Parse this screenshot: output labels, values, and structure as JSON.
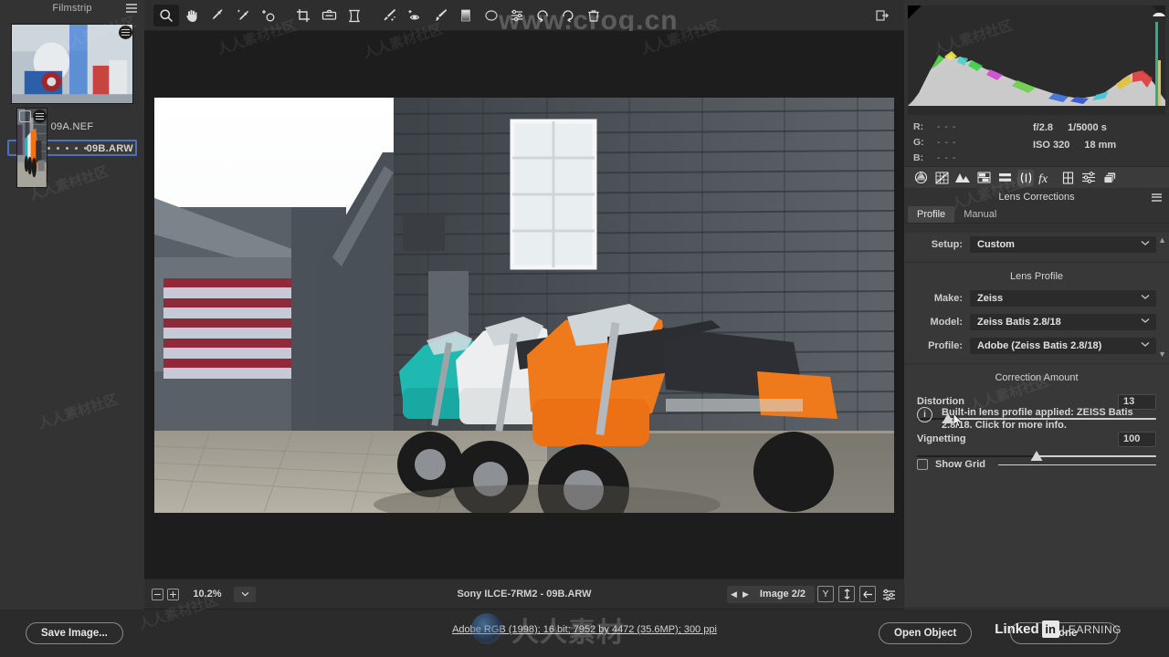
{
  "filmstrip": {
    "title": "Filmstrip",
    "menu_icon": "hamburger-icon",
    "items": [
      {
        "name": "09A.NEF",
        "selected": false,
        "dots": 0
      },
      {
        "name": "09B.ARW",
        "selected": true,
        "dots": 5
      }
    ]
  },
  "toolbar": {
    "tools": [
      {
        "name": "zoom-tool",
        "icon": "magnifier-icon",
        "active": true
      },
      {
        "name": "hand-tool",
        "icon": "hand-icon",
        "active": false
      },
      {
        "name": "white-balance-tool",
        "icon": "eyedropper-icon",
        "active": false
      },
      {
        "name": "color-sampler-tool",
        "icon": "eyedropper-sparkle-icon",
        "active": false
      },
      {
        "name": "targeted-adjustment-tool",
        "icon": "target-adjust-icon",
        "active": false
      },
      {
        "name": "crop-tool",
        "icon": "crop-icon",
        "active": false
      },
      {
        "name": "straighten-tool",
        "icon": "straighten-icon",
        "active": false
      },
      {
        "name": "transform-tool",
        "icon": "transform-icon",
        "active": false
      },
      {
        "name": "spot-removal-tool",
        "icon": "spot-heal-icon",
        "active": false
      },
      {
        "name": "adjustment-brush-tool",
        "icon": "brush-icon",
        "active": false
      },
      {
        "name": "red-eye-tool",
        "icon": "red-eye-icon",
        "active": false
      },
      {
        "name": "mask-brush-tool",
        "icon": "paint-brush-icon",
        "active": false
      },
      {
        "name": "graduated-filter-tool",
        "icon": "gradient-icon",
        "active": false
      },
      {
        "name": "radial-filter-tool",
        "icon": "radial-filter-icon",
        "active": false
      },
      {
        "name": "preferences-tool",
        "icon": "sliders-icon",
        "active": false
      },
      {
        "name": "rotate-counterclockwise-tool",
        "icon": "rotate-left-icon",
        "active": false
      },
      {
        "name": "rotate-clockwise-tool",
        "icon": "rotate-right-icon",
        "active": false
      },
      {
        "name": "delete-tool",
        "icon": "trash-icon",
        "active": false
      }
    ],
    "toggle_fullscreen": "fullscreen-toggle-icon",
    "watermark": "www.crog.cn"
  },
  "statusbar": {
    "zoom_out_icon": "minus-box-icon",
    "zoom_in_icon": "plus-box-icon",
    "zoom_level": "10.2%",
    "zoom_dropdown_icon": "chevron-down-icon",
    "file_label": "Sony ILCE-7RM2  -  09B.ARW",
    "prev_icon": "triangle-left-icon",
    "next_icon": "triangle-right-icon",
    "image_count": "Image 2/2",
    "buttons": [
      {
        "name": "preview-toggle-button",
        "label": "Y"
      },
      {
        "name": "sync-settings-button",
        "label": "sync-icon"
      },
      {
        "name": "filmstrip-toggle-button",
        "label": "arrow-left-icon"
      },
      {
        "name": "filmstrip-options-button",
        "label": "sliders-icon"
      }
    ]
  },
  "right_panel": {
    "histogram": {
      "shadow_clipping_icon": "triangle-clip-shadow",
      "highlight_clipping_icon": "triangle-clip-highlight"
    },
    "readout": {
      "channels": [
        {
          "label": "R:",
          "value": "- - -"
        },
        {
          "label": "G:",
          "value": "- - -"
        },
        {
          "label": "B:",
          "value": "- - -"
        }
      ],
      "exif": {
        "aperture": "f/2.8",
        "shutter": "1/5000 s",
        "iso": "ISO 320",
        "focal_length": "18 mm"
      }
    },
    "tabs": [
      {
        "name": "tab-basic",
        "icon": "aperture-icon",
        "active": false
      },
      {
        "name": "tab-tone-curve",
        "icon": "curve-grid-icon",
        "active": false
      },
      {
        "name": "tab-detail",
        "icon": "mountains-icon",
        "active": false
      },
      {
        "name": "tab-color-mixer",
        "icon": "hsl-icon",
        "active": false
      },
      {
        "name": "tab-color-grading",
        "icon": "split-tone-icon",
        "active": false
      },
      {
        "name": "tab-optics",
        "icon": "lens-correction-icon",
        "active": true
      },
      {
        "name": "tab-effects",
        "icon": "fx-icon",
        "active": false
      },
      {
        "name": "tab-calibration",
        "icon": "calibration-icon",
        "active": false
      },
      {
        "name": "tab-presets",
        "icon": "presets-sliders-icon",
        "active": false
      },
      {
        "name": "tab-snapshots",
        "icon": "snapshots-layers-icon",
        "active": false
      }
    ],
    "panel_title": "Lens Corrections",
    "panel_menu_icon": "panel-menu-icon",
    "subtabs": [
      {
        "name": "subtab-profile",
        "label": "Profile",
        "active": true
      },
      {
        "name": "subtab-manual",
        "label": "Manual",
        "active": false
      }
    ],
    "setup": {
      "label": "Setup:",
      "value": "Custom"
    },
    "lens_profile": {
      "title": "Lens Profile",
      "make": {
        "label": "Make:",
        "value": "Zeiss"
      },
      "model": {
        "label": "Model:",
        "value": "Zeiss Batis 2.8/18"
      },
      "profile": {
        "label": "Profile:",
        "value": "Adobe (Zeiss Batis 2.8/18)"
      }
    },
    "correction_amount": {
      "title": "Correction Amount",
      "sliders": [
        {
          "name": "distortion-slider",
          "label": "Distortion",
          "value": "13",
          "pos_pct": 13,
          "max": 200
        },
        {
          "name": "vignetting-slider",
          "label": "Vignetting",
          "value": "100",
          "pos_pct": 50,
          "max": 200
        }
      ]
    },
    "info_icon": "info-circle-icon",
    "info_text": "Built-in lens profile applied: ZEISS Batis 2.8/18.  Click for more info.",
    "show_grid": {
      "label": "Show Grid",
      "checked": false
    }
  },
  "bottom": {
    "save_image_button": "Save Image...",
    "workflow_options": "Adobe RGB (1998); 16 bit; 7952 by 4472 (35.6MP); 300 ppi",
    "open_object_button": "Open Object",
    "done_button": "Done",
    "watermark": "Linked in LEARNING"
  },
  "colors": {
    "accent_blue": "#4a72c4",
    "panel_bg": "#383838",
    "chrome_bg": "#2b2b2b",
    "text": "#d6d6d6"
  }
}
